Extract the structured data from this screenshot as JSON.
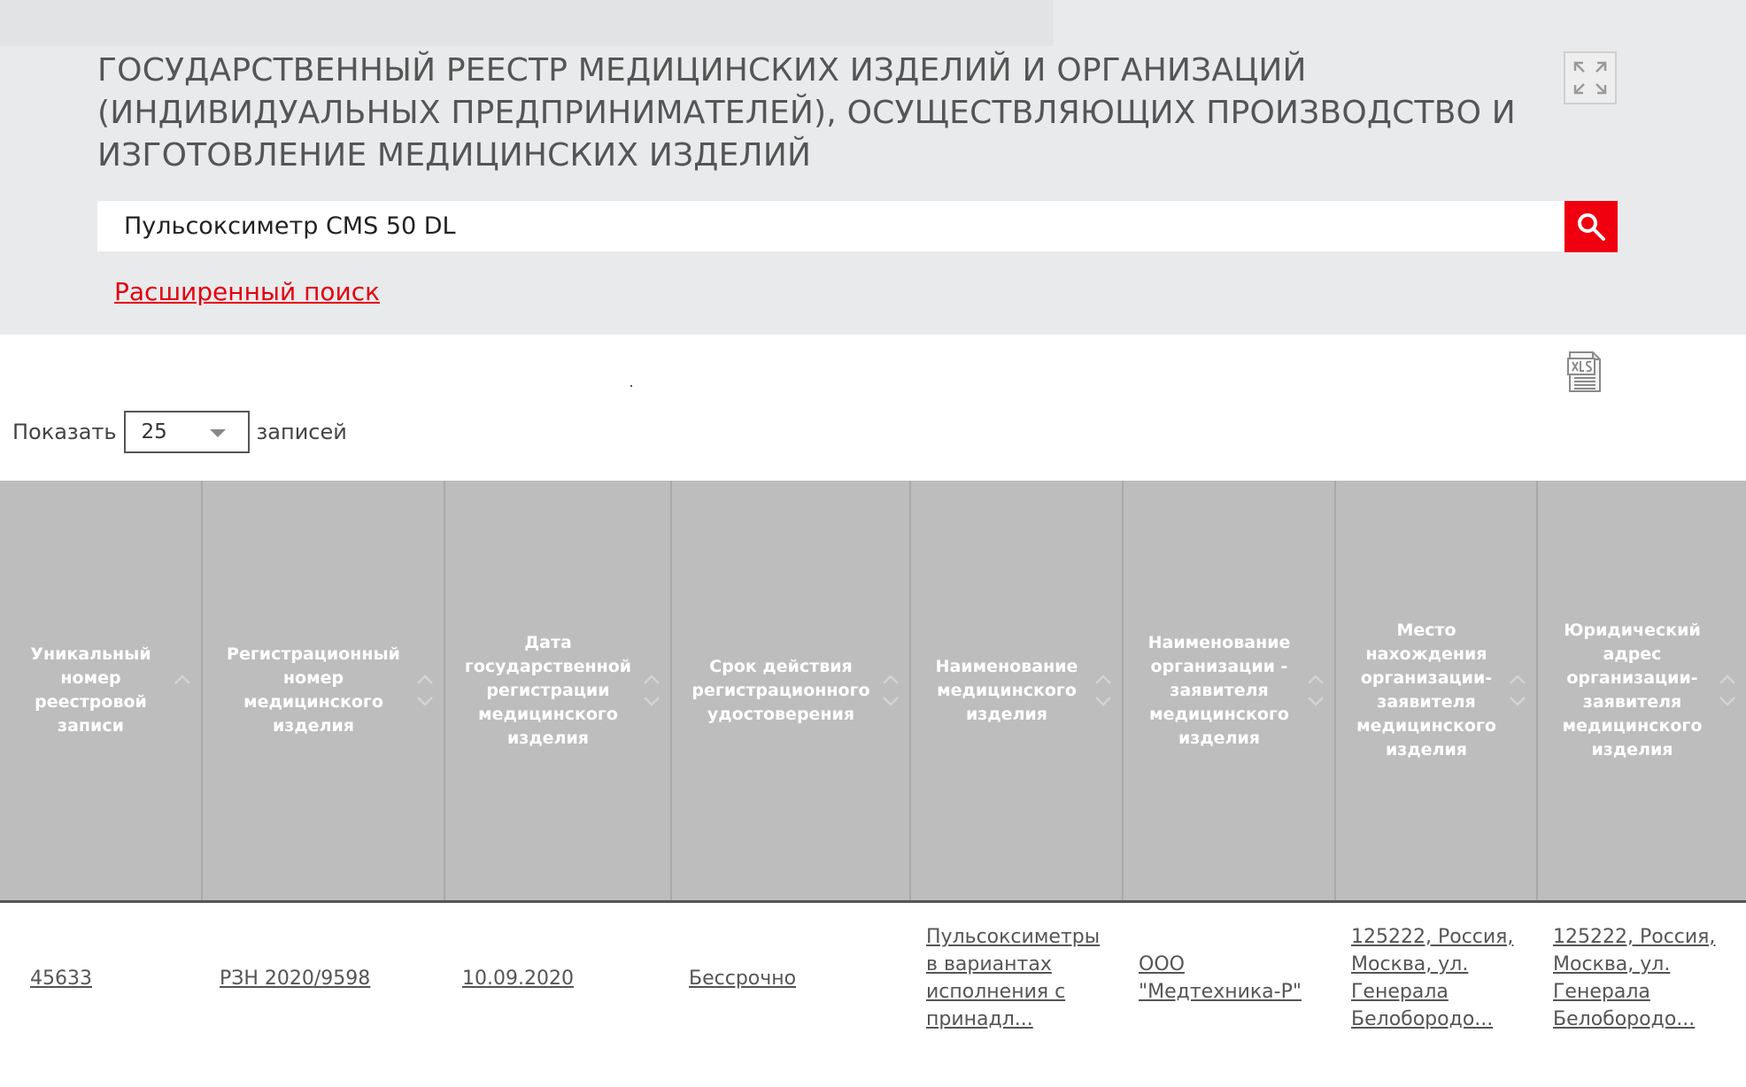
{
  "header": {
    "title_lines": [
      "ГОСУДАРСТВЕННЫЙ РЕЕСТР МЕДИЦИНСКИХ ИЗДЕЛИЙ И ОРГАНИЗАЦИЙ",
      "(ИНДИВИДУАЛЬНЫХ ПРЕДПРИНИМАТЕЛЕЙ), ОСУЩЕСТВЛЯЮЩИХ ПРОИЗВОДСТВО И",
      "ИЗГОТОВЛЕНИЕ МЕДИЦИНСКИХ ИЗДЕЛИЙ"
    ],
    "expand_icon": "fullscreen-icon"
  },
  "search": {
    "value": "Пульсоксиметр CMS 50 DL",
    "button_icon": "search-icon",
    "advanced_link": "Расширенный поиск"
  },
  "export": {
    "icon": "xls-export-icon"
  },
  "page_length": {
    "label_before": "Показать",
    "selected": "25",
    "label_after": "записей"
  },
  "table": {
    "columns": [
      "Уникальный номер реестровой записи",
      "Регистрационный номер медицинского изделия",
      "Дата государственной регистрации медицинского изделия",
      "Срок действия регистрационного удостоверения",
      "Наименование медицинского изделия",
      "Наименование организации - заявителя медицинского изделия",
      "Место нахождения организации-заявителя медицинского изделия",
      "Юридический адрес организации-заявителя медицинского изделия"
    ],
    "rows": [
      [
        "45633",
        "РЗН 2020/9598",
        "10.09.2020",
        "Бессрочно",
        "Пульсоксиметры в вариантах исполнения с принадл...",
        "ООО \"Медтехника-Р\"",
        "125222, Россия, Москва, ул. Генерала Белобородо...",
        "125222, Россия, Москва, ул. Генерала Белобородо..."
      ]
    ]
  },
  "colors": {
    "accent": "#f0000f",
    "link": "#e2000f",
    "header_band": "#e9eaeb",
    "table_header": "#bdbdbd"
  }
}
